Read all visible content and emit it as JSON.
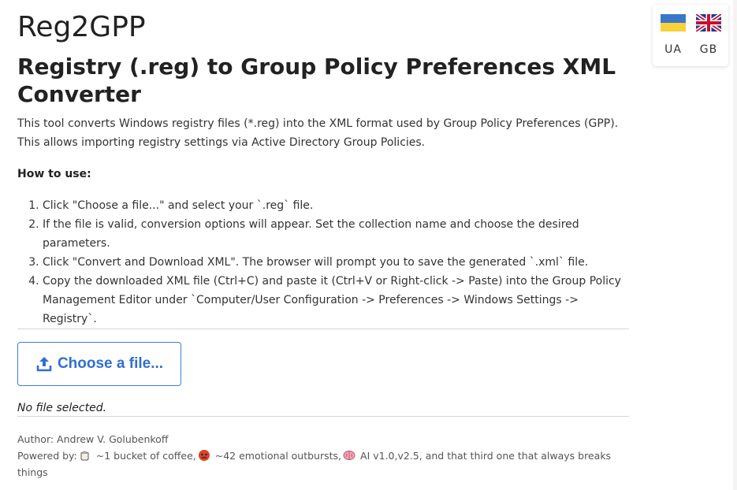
{
  "app_title": "Reg2GPP",
  "page_title": "Registry (.reg) to Group Policy Preferences XML Converter",
  "intro": "This tool converts Windows registry files (*.reg) into the XML format used by Group Policy Preferences (GPP). This allows importing registry settings via Active Directory Group Policies.",
  "how_to_title": "How to use:",
  "steps": [
    "Click \"Choose a file...\" and select your `.reg` file.",
    "If the file is valid, conversion options will appear. Set the collection name and choose the desired parameters.",
    "Click \"Convert and Download XML\". The browser will prompt you to save the generated `.xml` file.",
    "Copy the downloaded XML file (Ctrl+C) and paste it (Ctrl+V or Right-click -> Paste) into the Group Policy Management Editor under `Computer/User Configuration -> Preferences -> Windows Settings -> Registry`."
  ],
  "file_button": {
    "label": "Choose a file...",
    "icon": "upload-icon"
  },
  "file_status": "No file selected.",
  "footer": {
    "author": "Author: Andrew V. Golubenkoff",
    "powered_by_label": "Powered by:",
    "items": [
      {
        "icon": "coffee-icon",
        "text": "~1 bucket of coffee,"
      },
      {
        "icon": "angry-face-icon",
        "text": "~42 emotional outbursts,"
      },
      {
        "icon": "brain-icon",
        "text": "AI v1.0,v2.5, and that third one that always breaks things"
      }
    ]
  },
  "languages": [
    {
      "code": "UA",
      "icon": "ukraine-flag-icon"
    },
    {
      "code": "GB",
      "icon": "uk-flag-icon"
    }
  ],
  "colors": {
    "accent": "#2f6fd1",
    "button_border": "#3b7ddd",
    "divider": "#d6d6d6"
  }
}
